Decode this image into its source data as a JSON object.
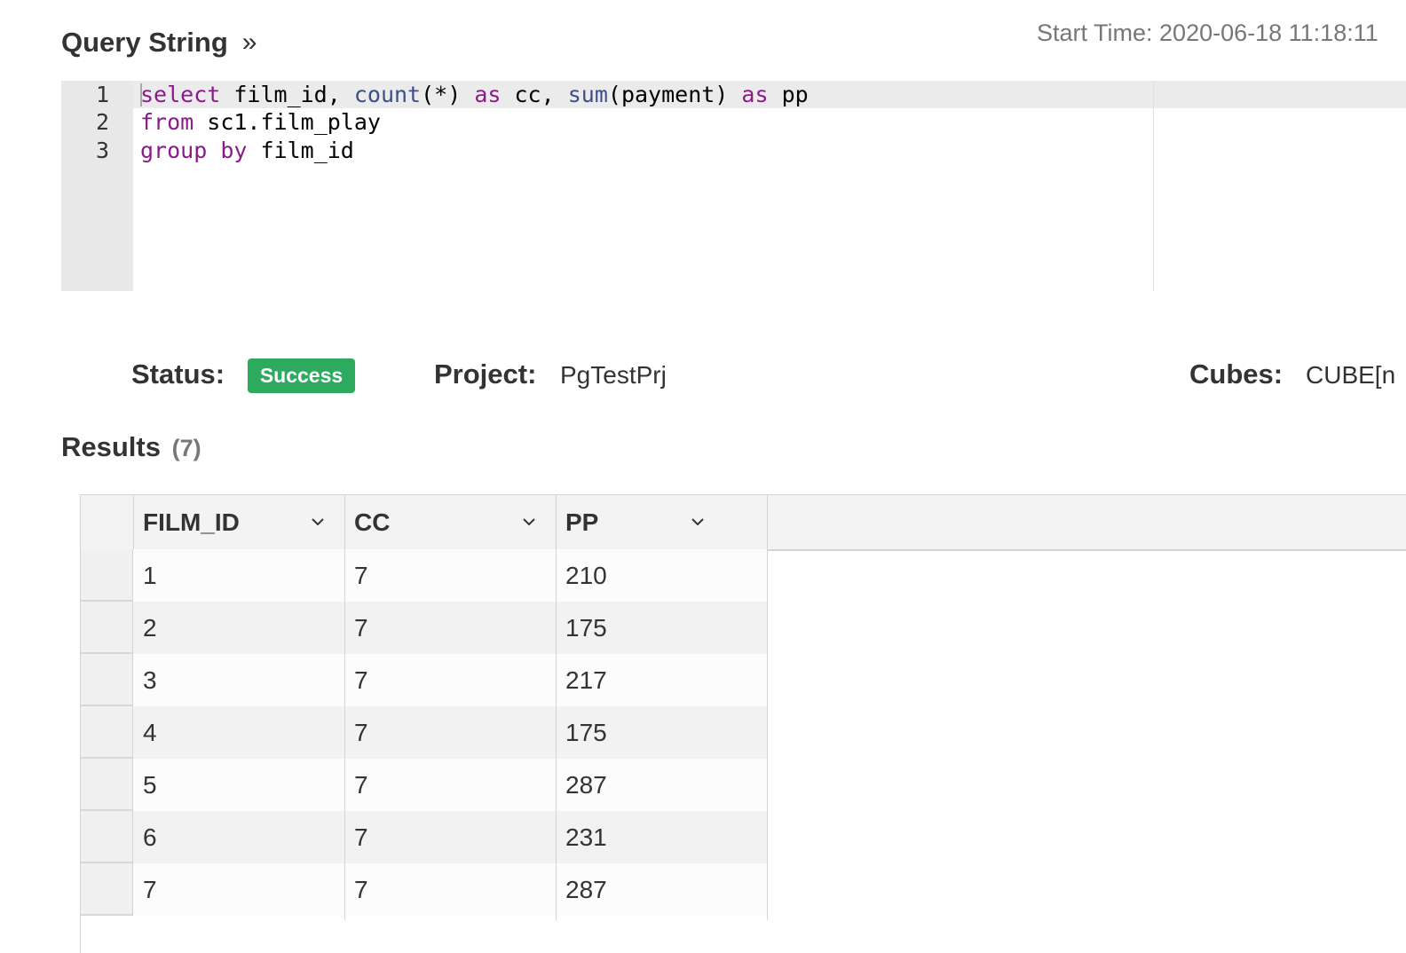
{
  "header": {
    "title": "Query String",
    "collapse_glyph": "»",
    "start_time": "Start Time: 2020-06-18 11:18:11"
  },
  "editor": {
    "line_numbers": [
      "1",
      "2",
      "3"
    ],
    "lines": [
      "select film_id, count(*) as cc, sum(payment) as pp",
      "from sc1.film_play",
      "group by film_id"
    ]
  },
  "status": {
    "status_label": "Status:",
    "status_value": "Success",
    "project_label": "Project:",
    "project_value": "PgTestPrj",
    "cubes_label": "Cubes:",
    "cubes_value": "CUBE[n"
  },
  "results": {
    "title": "Results",
    "count": "(7)",
    "columns": [
      "FILM_ID",
      "CC",
      "PP"
    ],
    "rows": [
      [
        "1",
        "7",
        "210"
      ],
      [
        "2",
        "7",
        "175"
      ],
      [
        "3",
        "7",
        "217"
      ],
      [
        "4",
        "7",
        "175"
      ],
      [
        "5",
        "7",
        "287"
      ],
      [
        "6",
        "7",
        "231"
      ],
      [
        "7",
        "7",
        "287"
      ]
    ]
  },
  "colors": {
    "success_badge": "#2cab5e",
    "sql_keyword": "#8b1a8b",
    "sql_function": "#3e4e86"
  },
  "icons": {
    "collapse": "double-chevron-right-icon",
    "column_menu": "chevron-down-icon"
  }
}
